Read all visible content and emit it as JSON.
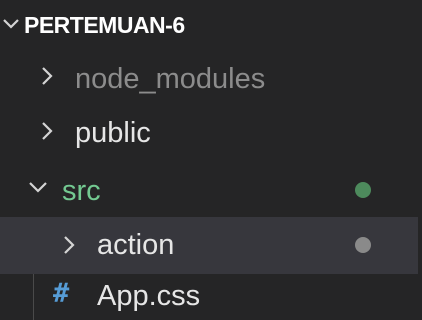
{
  "explorer": {
    "section_title": "PERTEMUAN-6",
    "items": [
      {
        "label": "node_modules",
        "type": "folder",
        "expanded": false,
        "dimmed": true
      },
      {
        "label": "public",
        "type": "folder",
        "expanded": false
      },
      {
        "label": "src",
        "type": "folder",
        "expanded": true,
        "git_status": "modified",
        "status_color": "#4d8a5c"
      },
      {
        "label": "action",
        "type": "folder",
        "expanded": false,
        "selected": true,
        "status_color": "#8a8a8a"
      },
      {
        "label": "App.css",
        "type": "file",
        "file_icon": "#"
      }
    ]
  },
  "colors": {
    "background": "#252526",
    "selected_row": "#37373d",
    "text": "#e6e6e6",
    "dimmed_text": "#8c8c8c",
    "git_modified": "#73c991",
    "css_icon": "#569cd6"
  },
  "icons": {
    "section_toggle": "chevron-down-icon",
    "collapsed": "chevron-right-icon",
    "expanded": "chevron-down-icon",
    "css_file": "hash-icon"
  }
}
